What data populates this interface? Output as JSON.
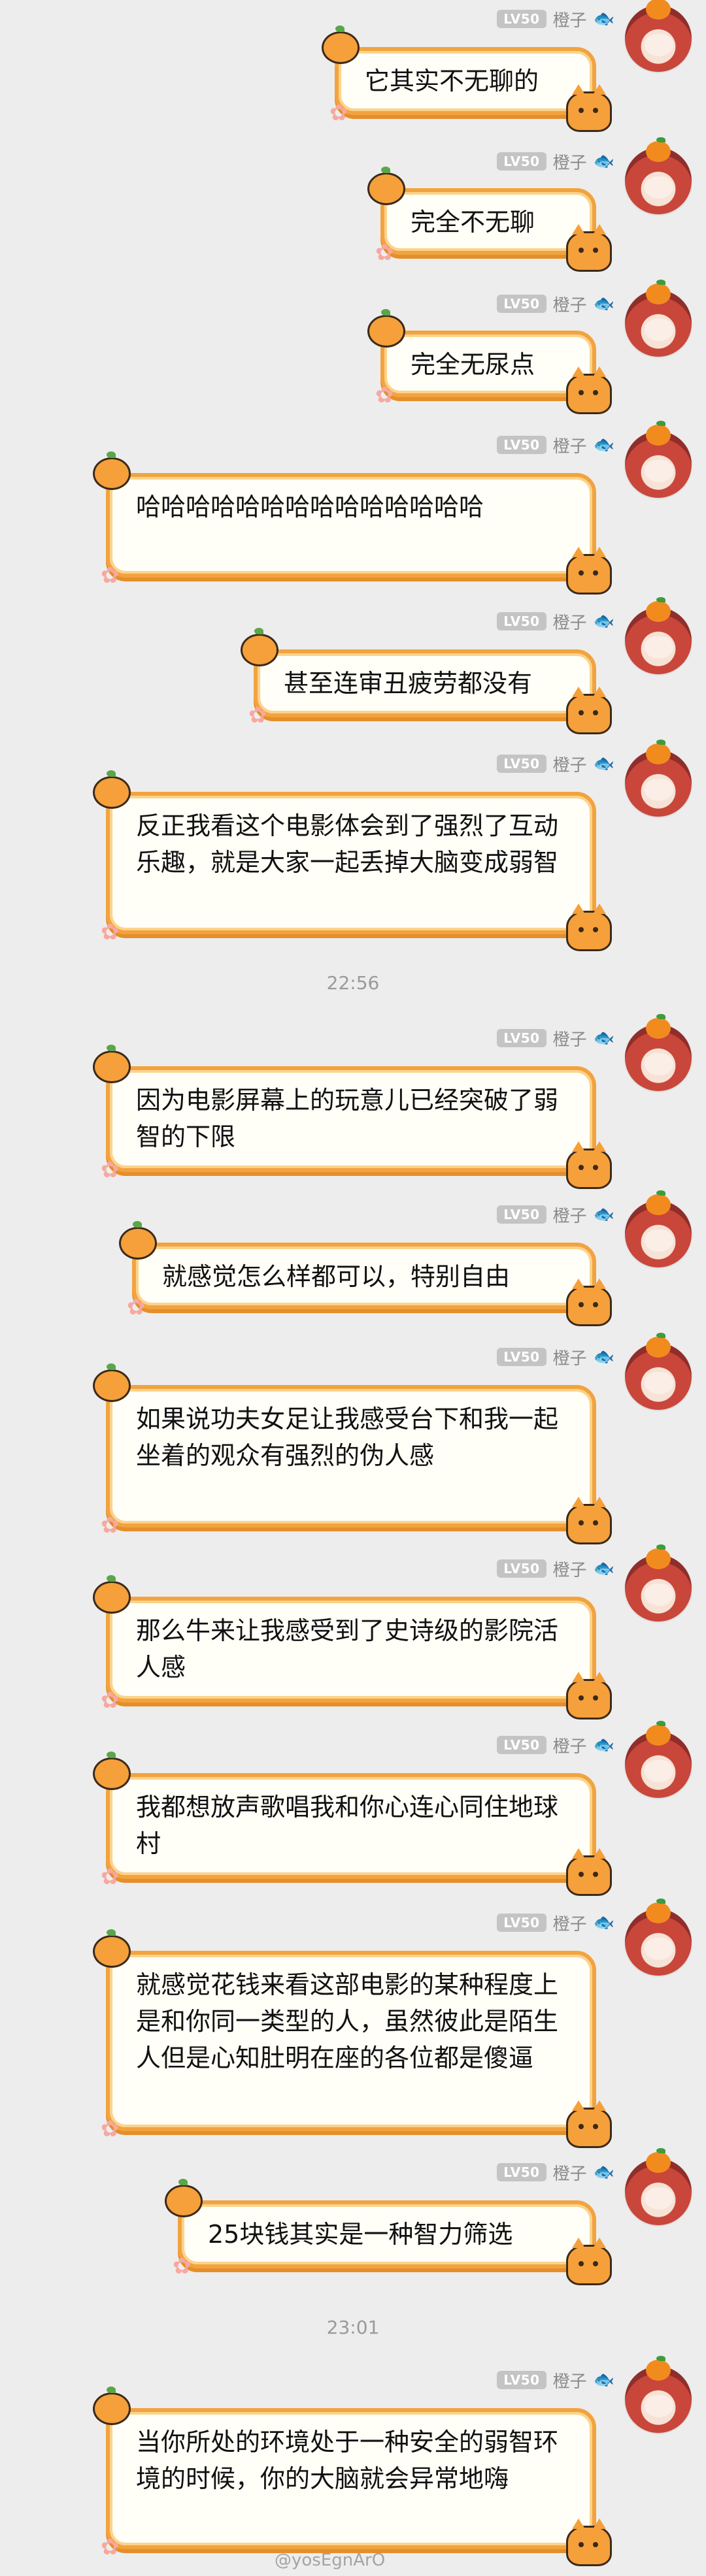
{
  "sender": {
    "level": "LV50",
    "name": "橙子"
  },
  "messages": [
    {
      "text": "它其实不无聊的"
    },
    {
      "text": "完全不无聊"
    },
    {
      "text": "完全无尿点"
    },
    {
      "text": "哈哈哈哈哈哈哈哈哈哈哈哈哈哈"
    },
    {
      "text": "甚至连审丑疲劳都没有"
    },
    {
      "text": "反正我看这个电影体会到了强烈了互动乐趣，就是大家一起丢掉大脑变成弱智"
    },
    {
      "text": "因为电影屏幕上的玩意儿已经突破了弱智的下限"
    },
    {
      "text": "就感觉怎么样都可以，特别自由"
    },
    {
      "text": "如果说功夫女足让我感受台下和我一起坐着的观众有强烈的伪人感"
    },
    {
      "text": "那么牛来让我感受到了史诗级的影院活人感"
    },
    {
      "text": "我都想放声歌唱我和你心连心同住地球村"
    },
    {
      "text": "就感觉花钱来看这部电影的某种程度上是和你同一类型的人，虽然彼此是陌生人但是心知肚明在座的各位都是傻逼"
    },
    {
      "text": "25块钱其实是一种智力筛选"
    },
    {
      "text": "当你所处的环境处于一种安全的弱智环境的时候，你的大脑就会异常地嗨"
    }
  ],
  "timestamps": [
    "22:56",
    "23:01"
  ],
  "watermark": "@yosEgnArO",
  "colors": {
    "background": "#ededed",
    "bubble_border": "#f2a33f",
    "bubble_fill": "#fffef7",
    "level_badge": "#c4c4c4",
    "name_text": "#8a8a8a",
    "timestamp_text": "#9a9a9a"
  },
  "icons": {
    "level_badge": "level-badge",
    "fish_emblem": "fish-icon",
    "avatar": "avatar-orange-hair-icon",
    "bubble_decor": [
      "orange-fruit-icon",
      "paw-print-icon",
      "cat-face-icon"
    ]
  }
}
